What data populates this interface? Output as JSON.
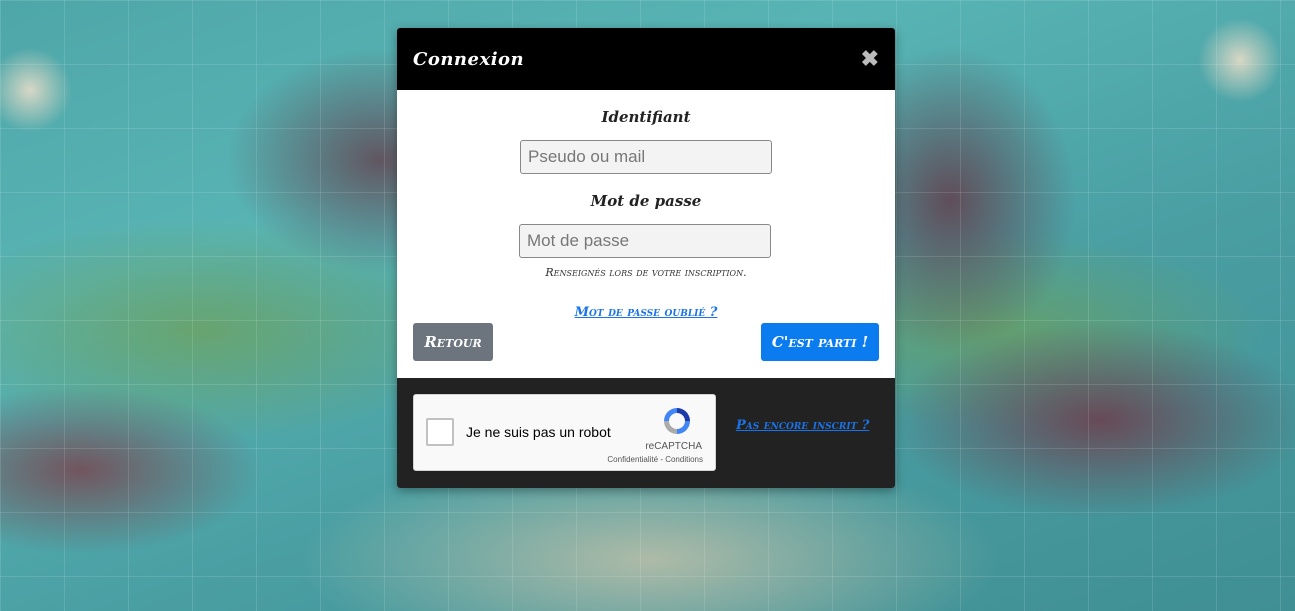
{
  "modal": {
    "title": "Connexion",
    "close_icon": "close-icon"
  },
  "form": {
    "id_label": "Identifiant",
    "id_placeholder": "Pseudo ou mail",
    "password_label": "Mot de passe",
    "password_placeholder": "Mot de passe",
    "hint": "Renseignés lors de votre inscription.",
    "forgot_link": "Mot de passe oublié ?",
    "back_button": "Retour",
    "submit_button": "C'est parti !"
  },
  "footer": {
    "captcha_label": "Je ne suis pas un robot",
    "captcha_brand": "reCAPTCHA",
    "captcha_terms": "Confidentialité - Conditions",
    "signup_link": "Pas encore inscrit ?"
  },
  "colors": {
    "primary": "#0b7cf0",
    "secondary": "#6c757d",
    "header": "#000000",
    "footer": "#222222",
    "link": "#1a73e8"
  }
}
